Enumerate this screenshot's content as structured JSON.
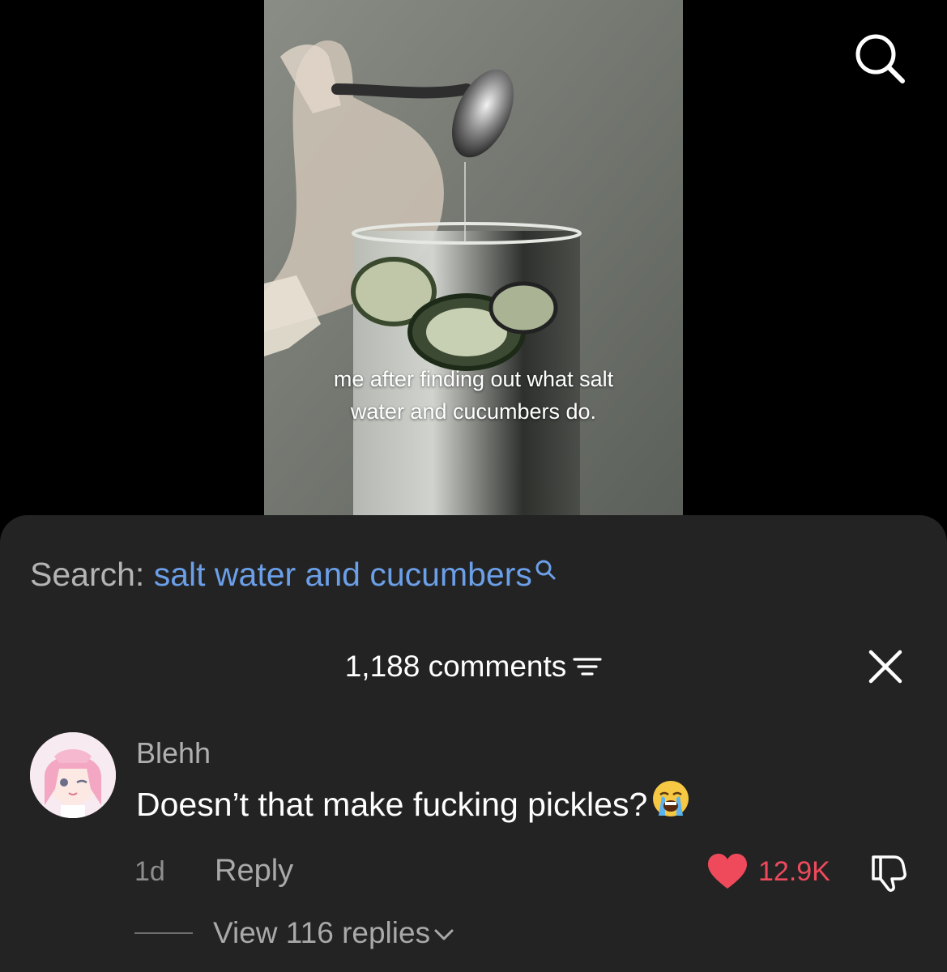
{
  "video": {
    "caption_line1": "me after finding out what salt",
    "caption_line2": "water and cucumbers do."
  },
  "top_bar": {
    "search_icon": "search-icon"
  },
  "comments": {
    "search_label": "Search:",
    "search_query": "salt water and cucumbers",
    "count_label": "1,188 comments",
    "sort_icon": "filter-icon",
    "close_icon": "close-icon",
    "items": [
      {
        "username": "Blehh",
        "text": "Doesn’t that make fucking pickles?",
        "emoji": "loudly-crying-face",
        "time": "1d",
        "reply_label": "Reply",
        "like_count": "12.9K",
        "view_replies": "View 116 replies"
      }
    ]
  },
  "colors": {
    "sheet_bg": "#232323",
    "link_blue": "#6b9fe8",
    "like_red": "#ef4a5c"
  }
}
